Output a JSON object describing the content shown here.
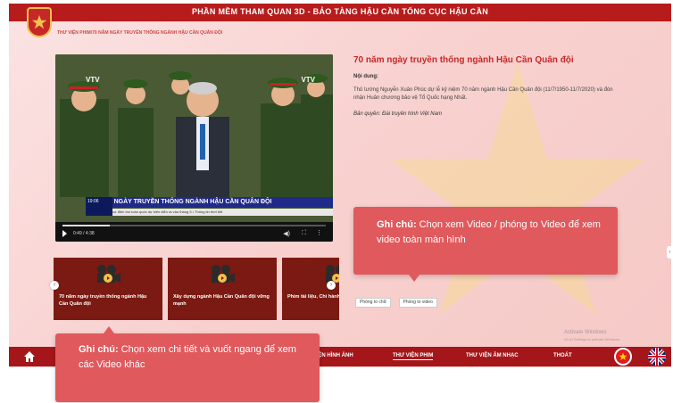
{
  "app_title": "PHẦN MỀM THAM QUAN 3D - BẢO TÀNG HẬU CẦN TỔNG CỤC HẬU CẦN",
  "breadcrumb": "THƯ VIỆN PHIM/70 NĂM NGÀY TRUYỀN THỐNG NGÀNH HẬU CẦN QUÂN ĐỘI",
  "player": {
    "caption": "70 NĂM NGÀY TRUYỀN THỐNG NGÀNH HẬU CẦN QUÂN ĐỘI",
    "clock": "19:06",
    "ticker": "Hoa tiêu nhân cự điên tòn toàn quốc dự kiến diễn ra vào tháng 5   •   Thông tin thời tiết",
    "badge": "VTV",
    "time": "0:49 / 4:38",
    "progress": 0.18
  },
  "detail": {
    "title": "70 năm ngày truyền thống ngành Hậu Cần Quân đội",
    "content_label": "Nội dung:",
    "content_text": "Thủ tướng Nguyễn Xuân Phúc dự lễ kỷ niệm 70 năm ngành Hậu Cần Quân đội (11/7/1950-11/7/2020) và đón nhận Huân chương bảo vệ Tổ Quốc hạng Nhất.",
    "copyright": "Bản quyền: Đài truyền hình Việt Nam"
  },
  "thumbnails": [
    {
      "label": "70 năm ngày truyền thống ngành Hậu Cần Quân đội"
    },
    {
      "label": "Xây dựng ngành Hậu Cần Quân đội vững mạnh"
    },
    {
      "label": "Phim tài liệu, Chi hành khúc ca"
    }
  ],
  "tabs": {
    "note_label": "Phóng to chữ",
    "video_label": "Phóng to video"
  },
  "watermark": {
    "line1": "Activate Windows",
    "line2": "Go to Settings to activate Windows."
  },
  "nav": {
    "items": [
      {
        "label": "THƯ VIỆN HÌNH ẢNH",
        "active": false
      },
      {
        "label": "THƯ VIỆN PHIM",
        "active": true
      },
      {
        "label": "THƯ VIỆN ÂM NHẠC",
        "active": false
      },
      {
        "label": "THOÁT",
        "active": false
      }
    ]
  },
  "callouts": {
    "right": {
      "prefix": "Ghi chú:",
      "text": " Chọn xem Video / phóng to Video để xem video toàn màn hình"
    },
    "left": {
      "prefix": "Ghi chú:",
      "text": " Chọn xem chi tiết và vuốt ngang để xem các Video khác"
    }
  },
  "colors": {
    "brand_red": "#b71c1c",
    "accent_red": "#c62828",
    "callout": "#e0595c"
  },
  "icons": [
    "home-icon",
    "play-icon",
    "volume-icon",
    "fullscreen-icon",
    "more-icon",
    "film-camera-icon",
    "chevron-left-icon",
    "chevron-right-icon",
    "vietnam-flag-icon",
    "uk-flag-icon",
    "star-emblem-icon"
  ]
}
